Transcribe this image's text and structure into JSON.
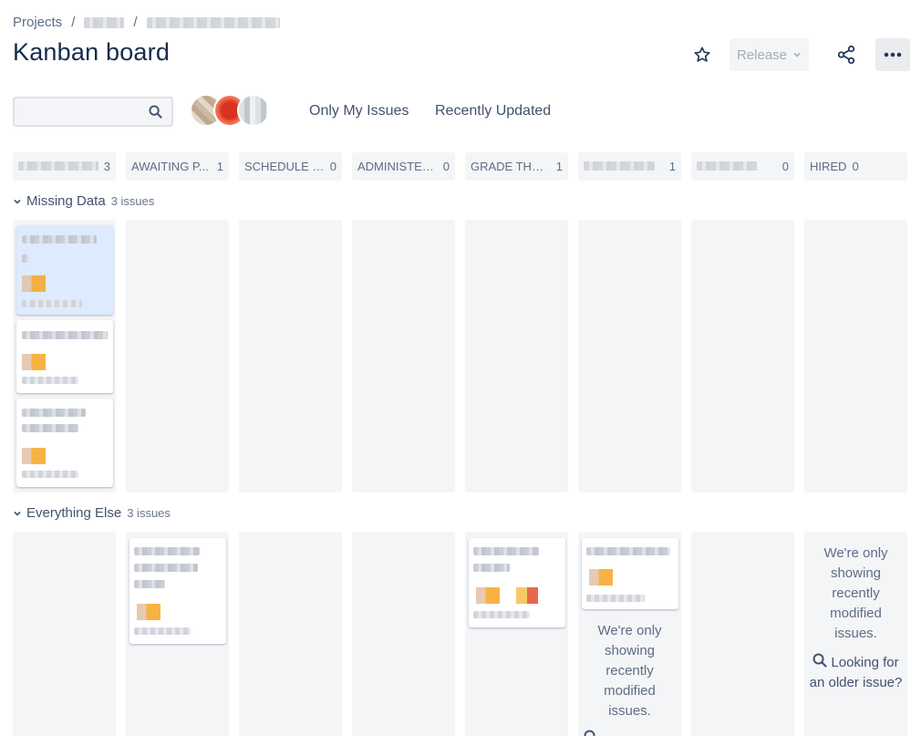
{
  "breadcrumb": {
    "projects": "Projects",
    "sep": "/"
  },
  "title": "Kanban board",
  "header": {
    "release_label": "Release"
  },
  "search": {
    "placeholder": ""
  },
  "filters": {
    "only_my_issues": "Only My Issues",
    "recently_updated": "Recently Updated"
  },
  "columns": [
    {
      "name": "",
      "count": "3"
    },
    {
      "name": "AWAITING P...",
      "count": "1"
    },
    {
      "name": "SCHEDULE P...",
      "count": "0"
    },
    {
      "name": "ADMINISTER ...",
      "count": "0"
    },
    {
      "name": "GRADE THE T...",
      "count": "1"
    },
    {
      "name": "",
      "count": "1"
    },
    {
      "name": "",
      "count": "0"
    },
    {
      "name": "HIRED",
      "count": "0"
    }
  ],
  "swimlanes": [
    {
      "name": "Missing Data",
      "issues": "3 issues"
    },
    {
      "name": "Everything Else",
      "issues": "3 issues"
    }
  ],
  "empty_message": {
    "line1": "We're only",
    "line2": "showing",
    "line3": "recently",
    "line4": "modified",
    "line5": "issues."
  },
  "older_link": {
    "line1": "Looking for",
    "line2": "an older issue?"
  },
  "colors": {
    "text": "#172b4d",
    "muted": "#5e6c84",
    "column_bg": "#f4f5f7",
    "selected_card": "#deebff"
  },
  "icons": {
    "star": "star-icon",
    "share": "share-icon",
    "more": "more-icon",
    "search": "search-icon",
    "chevron": "chevron-down-icon"
  }
}
